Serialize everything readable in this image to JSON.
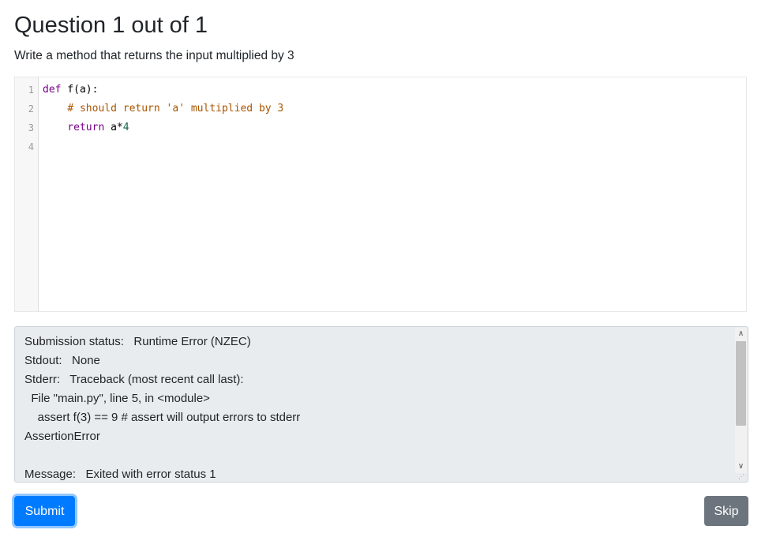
{
  "header": {
    "title": "Question 1 out of 1",
    "prompt": "Write a method that returns the input multiplied by 3"
  },
  "editor": {
    "line_numbers": [
      "1",
      "2",
      "3",
      "4"
    ],
    "lines": [
      {
        "kw": "def",
        "rest": " f(a):"
      },
      {
        "indent": "    ",
        "comment": "# should return 'a' multiplied by 3"
      },
      {
        "indent": "    ",
        "kw": "return",
        "rest": " a*",
        "num": "4"
      },
      {}
    ]
  },
  "output": {
    "lines": [
      "Submission status:   Runtime Error (NZEC)",
      "Stdout:   None",
      "Stderr:   Traceback (most recent call last):",
      "  File \"main.py\", line 5, in <module>",
      "    assert f(3) == 9 # assert will output errors to stderr",
      "AssertionError",
      "",
      "Message:   Exited with error status 1"
    ]
  },
  "actions": {
    "submit_label": "Submit",
    "skip_label": "Skip"
  },
  "colors": {
    "primary": "#007bff",
    "secondary": "#6c757d",
    "output_bg": "#e9ecef",
    "keyword": "#770088",
    "comment": "#aa5500",
    "number": "#116644"
  },
  "icons": {
    "scroll_up": "chevron-up-icon",
    "scroll_down": "chevron-down-icon",
    "resize": "resize-grip-icon"
  }
}
